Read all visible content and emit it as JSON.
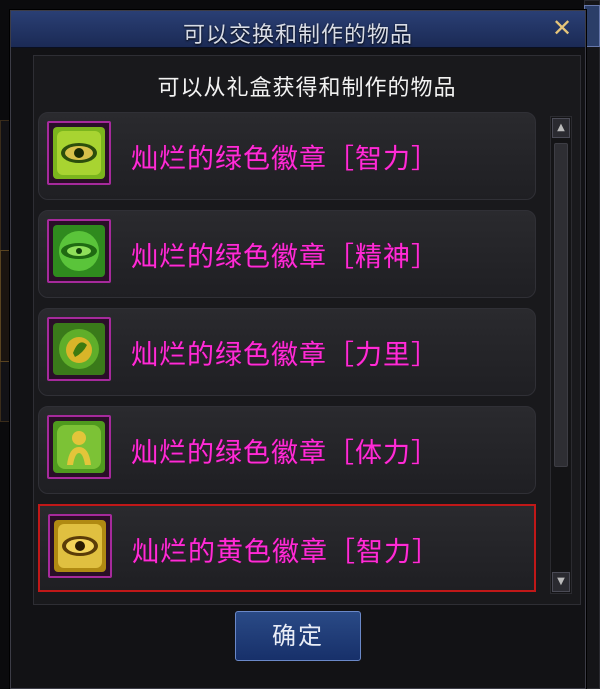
{
  "window": {
    "title": "可以交换和制作的物品",
    "close_label": "✕",
    "subtitle": "可以从礼盒获得和制作的物品"
  },
  "items": [
    {
      "label": "灿烂的绿色徽章［智力］",
      "icon": "green-eye-emblem-icon",
      "color": "#5a9a1a"
    },
    {
      "label": "灿烂的绿色徽章［精神］",
      "icon": "green-sphere-emblem-icon",
      "color": "#3ca32a"
    },
    {
      "label": "灿烂的绿色徽章［力里］",
      "icon": "green-fist-emblem-icon",
      "color": "#4a9a2a"
    },
    {
      "label": "灿烂的绿色徽章［体力］",
      "icon": "green-figure-emblem-icon",
      "color": "#5aa22a"
    },
    {
      "label": "灿烂的黄色徽章［智力］",
      "icon": "yellow-eye-emblem-icon",
      "color": "#c29a1a"
    }
  ],
  "selected_index": 4,
  "ok_button": "确定",
  "colors": {
    "item_text": "#ff2bd6",
    "titlebar": "#24386a",
    "selection_border": "#c01818",
    "icon_frame": "#a62a9c"
  }
}
